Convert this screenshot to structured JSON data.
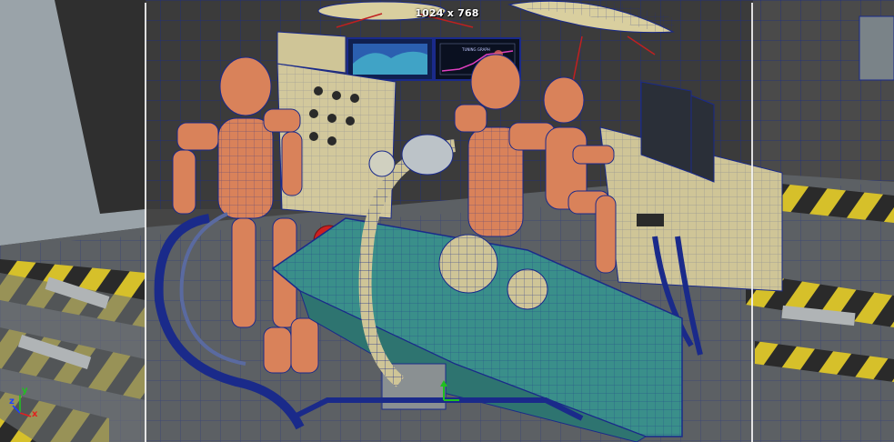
{
  "viewport": {
    "resolution_gate_label": "1024 x 768",
    "camera_name": "",
    "axis_labels": {
      "x": "x",
      "y": "y",
      "z": "z"
    },
    "colors": {
      "wire": "#1a2a8a",
      "robot": "#d9825a",
      "table": "#3a8f8a",
      "console": "#cdc39a",
      "gate": "#f2f2f2",
      "axis_x": "#e02020",
      "axis_y": "#20c020",
      "axis_z": "#2040ff"
    }
  },
  "screens": {
    "left_monitor": "",
    "right_monitor_title": "TUNING GRAPH"
  }
}
